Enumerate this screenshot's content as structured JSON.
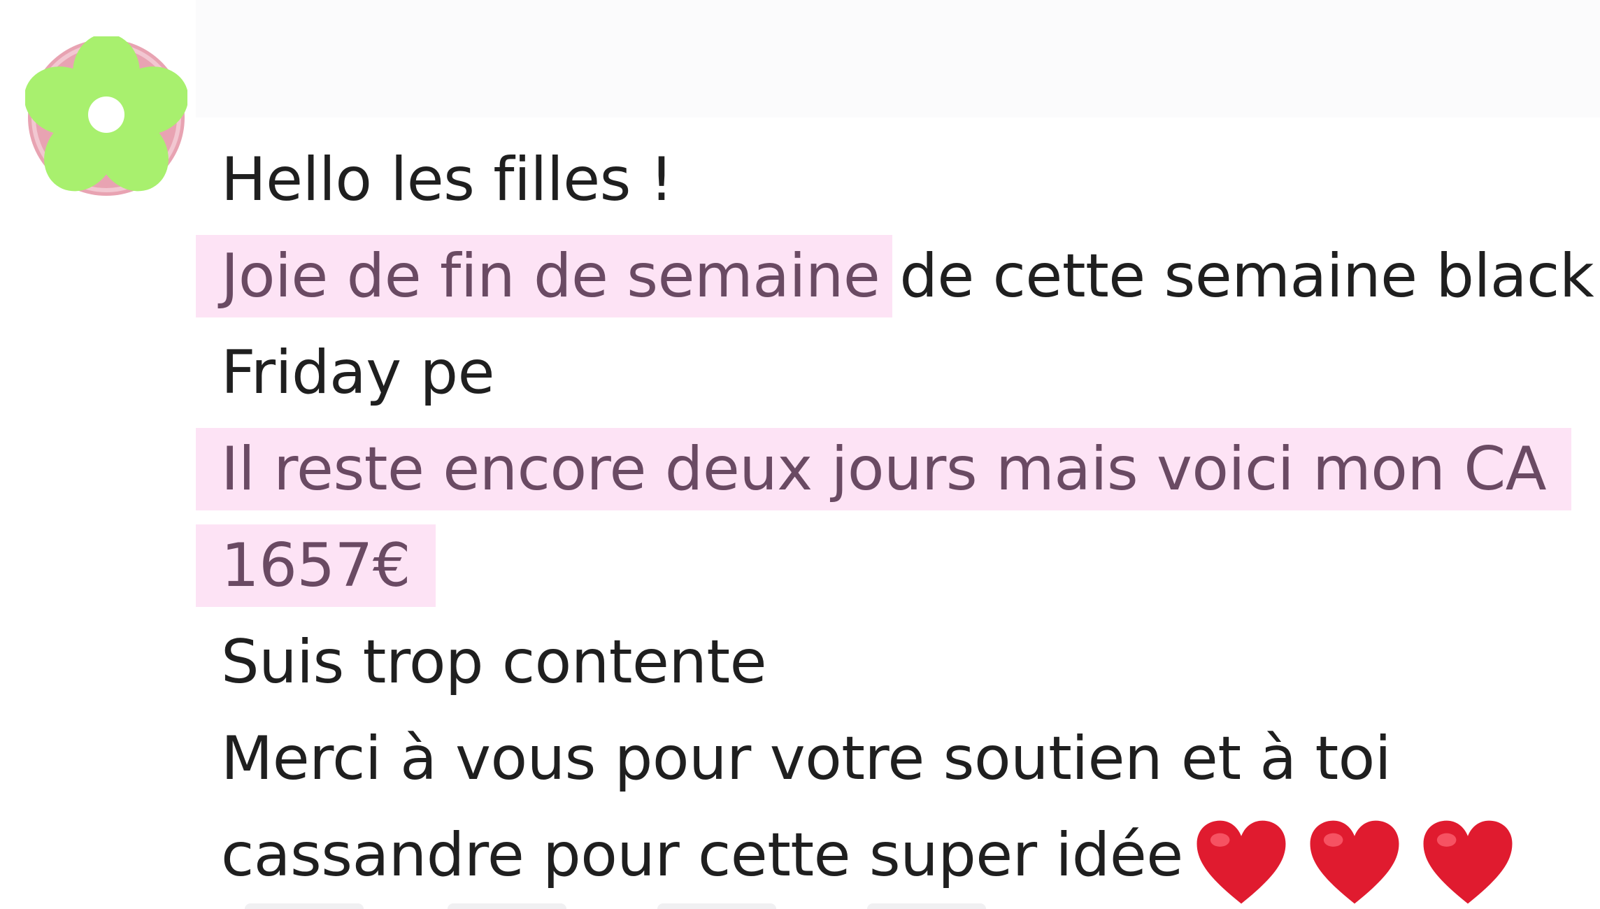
{
  "message": {
    "line1": "Hello les filles !",
    "line2_highlight": "Joie de fin de semaine",
    "line2_rest": "de cette semaine black",
    "line3": "Friday pe",
    "line4_highlight": "Il reste encore deux jours mais voici mon CA",
    "line5_highlight": "1657€",
    "line6": "Suis trop contente",
    "line7": "Merci à vous pour votre soutien et à toi",
    "line8": "cassandre pour cette super idée"
  },
  "icons": {
    "avatar": "flower-avatar-icon",
    "heart": "red-heart-icon"
  },
  "colors": {
    "text": "#1f1f1f",
    "highlight_bg": "#fde3f5",
    "highlight_text": "#6a4a63",
    "heart": "#e01b2f",
    "avatar_ring": "#e8a3b2",
    "avatar_petal": "#a8f06e"
  }
}
